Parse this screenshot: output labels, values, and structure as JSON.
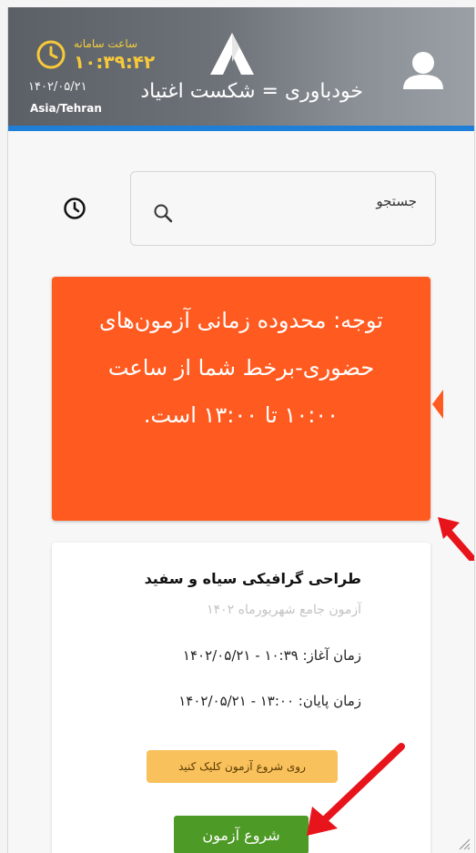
{
  "header": {
    "system_time_label": "ساعت سامانه",
    "system_time": "۱۰:۳۹:۴۲",
    "date": "۱۴۰۲/۰۵/۲۱",
    "timezone": "Asia/Tehran",
    "title": "خودباوری = شکست اغتیاد"
  },
  "search": {
    "placeholder": "جستجو"
  },
  "notice": {
    "text": "توجه: محدوده زمانی آزمون‌های حضوری-برخط شما از ساعت ۱۰:۰۰ تا ۱۳:۰۰ است."
  },
  "exam": {
    "title": "طراحی گرافیکی سیاه و سفید",
    "subtitle": "آزمون جامع شهریورماه ۱۴۰۲",
    "start": "زمان آغاز: ۱۰:۳۹ - ۱۴۰۲/۰۵/۲۱",
    "end": "زمان پایان: ۱۳:۰۰ - ۱۴۰۲/۰۵/۲۱",
    "hint": "روی شروع آزمون کلیک کنید",
    "start_button": "شروع آزمون"
  },
  "colors": {
    "header_accent": "#1f7fd8",
    "clock": "#f7c93a",
    "notice_bg": "#ff5a1f",
    "hint_bg": "#f8c15c",
    "start_button_bg": "#4e9a26",
    "annotation_arrow": "#e8141c"
  },
  "icons": [
    "clock-icon",
    "logo-icon",
    "avatar-icon",
    "history-icon",
    "search-icon",
    "resize-grip-icon"
  ]
}
